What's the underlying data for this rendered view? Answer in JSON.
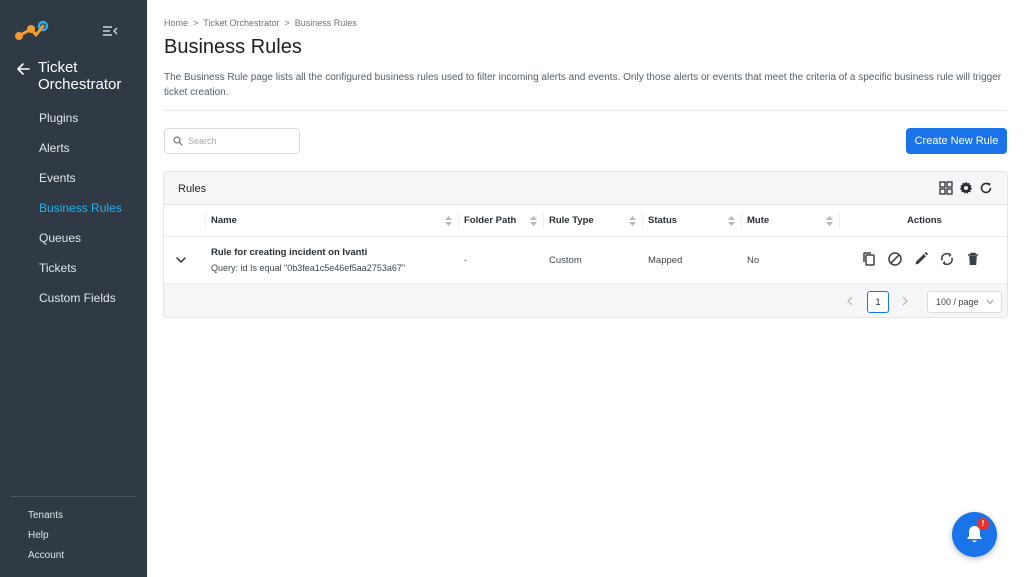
{
  "sidebar": {
    "app_title": "Ticket Orchestrator",
    "items": [
      {
        "label": "Plugins"
      },
      {
        "label": "Alerts"
      },
      {
        "label": "Events"
      },
      {
        "label": "Business Rules",
        "active": true
      },
      {
        "label": "Queues"
      },
      {
        "label": "Tickets"
      },
      {
        "label": "Custom Fields"
      }
    ],
    "footer": [
      {
        "label": "Tenants"
      },
      {
        "label": "Help"
      },
      {
        "label": "Account"
      }
    ]
  },
  "breadcrumb": [
    "Home",
    "Ticket Orchestrator",
    "Business Rules"
  ],
  "breadcrumb_separator": ">",
  "page": {
    "title": "Business Rules",
    "description": "The Business Rule page lists all the configured business rules used to filter incoming alerts and events. Only those alerts or events that meet the criteria of a specific business rule will trigger ticket creation."
  },
  "search": {
    "placeholder": "Search",
    "value": ""
  },
  "create_button": {
    "label": "Create New Rule"
  },
  "panel": {
    "title": "Rules",
    "columns": [
      "Name",
      "Folder Path",
      "Rule Type",
      "Status",
      "Mute",
      "Actions"
    ],
    "rows": [
      {
        "name": "Rule for creating incident on Ivanti",
        "query": "Query: id Is equal \"0b3fea1c5e46ef5aa2753a67\"",
        "folder_path": "-",
        "rule_type": "Custom",
        "status": "Mapped",
        "mute": "No"
      }
    ],
    "pagination": {
      "current_page": "1",
      "page_size": "100 / page"
    }
  },
  "notifications": {
    "badge": "!"
  },
  "colors": {
    "sidebar_bg": "#2f3a44",
    "accent": "#26b1ef",
    "primary": "#1a73e8",
    "badge": "#e5322d"
  },
  "icons": {
    "logo": "brand-logo-icon",
    "collapse": "collapse-menu-icon",
    "back": "arrow-left-icon",
    "search": "search-icon",
    "grid": "grid-view-icon",
    "settings": "gear-icon",
    "refresh": "refresh-icon",
    "expand": "chevron-down-icon",
    "copy": "copy-icon",
    "mute": "block-icon",
    "edit": "pencil-icon",
    "sync": "sync-icon",
    "delete": "trash-icon",
    "bell": "bell-icon"
  }
}
